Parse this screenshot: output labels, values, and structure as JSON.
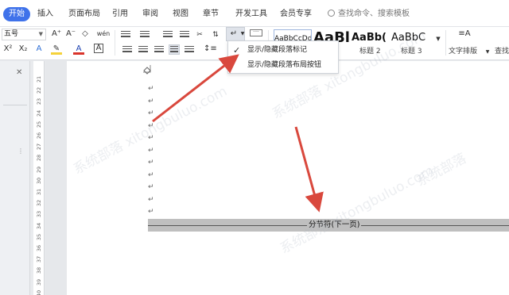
{
  "menubar": {
    "tabs": [
      {
        "label": "开始",
        "active": true
      },
      {
        "label": "插入"
      },
      {
        "label": "页面布局"
      },
      {
        "label": "引用"
      },
      {
        "label": "审阅"
      },
      {
        "label": "视图"
      },
      {
        "label": "章节"
      },
      {
        "label": "开发工具"
      },
      {
        "label": "会员专享"
      }
    ],
    "search_text": "查找命令、搜索模板"
  },
  "toolbar": {
    "font_size": "五号",
    "style_samples": [
      {
        "sample": "AaBbCcDd",
        "label": ""
      },
      {
        "sample": "AaBl",
        "label": "1"
      },
      {
        "sample": "AaBb(",
        "label": "标题 2"
      },
      {
        "sample": "AaBbC",
        "label": "标题 3"
      }
    ],
    "text_layout_label": "文字排版",
    "find_label": "查找",
    "icons": {
      "grow_font": "A⁺",
      "shrink_font": "A⁻",
      "clear_format": "◇",
      "phonetic": "wén",
      "superscript": "X²",
      "subscript": "X₂",
      "font_effect": "A",
      "highlight": "✎",
      "font_color": "A",
      "char_border": "A",
      "text_layout_glyph": "≡A"
    },
    "accent_color": "#3f72ea",
    "font_color": "#d9342b",
    "highlight_color": "#f5d23a"
  },
  "dropdown": {
    "items": [
      {
        "label": "显示/隐藏段落标记",
        "checked": true
      },
      {
        "label": "显示/隐藏段落布局按钮",
        "checked": false
      }
    ]
  },
  "ruler": {
    "numbers": [
      "21",
      "22",
      "23",
      "24",
      "25",
      "26",
      "27",
      "28",
      "29",
      "30",
      "31",
      "32",
      "33",
      "34",
      "35",
      "36",
      "37",
      "38",
      "39",
      "40"
    ]
  },
  "document": {
    "paragraph_mark": "↵",
    "section_break_label": "分节符(下一页)"
  },
  "watermark_text": "系统部落 xitongbuluo.com",
  "arrow_color": "#d9483d"
}
